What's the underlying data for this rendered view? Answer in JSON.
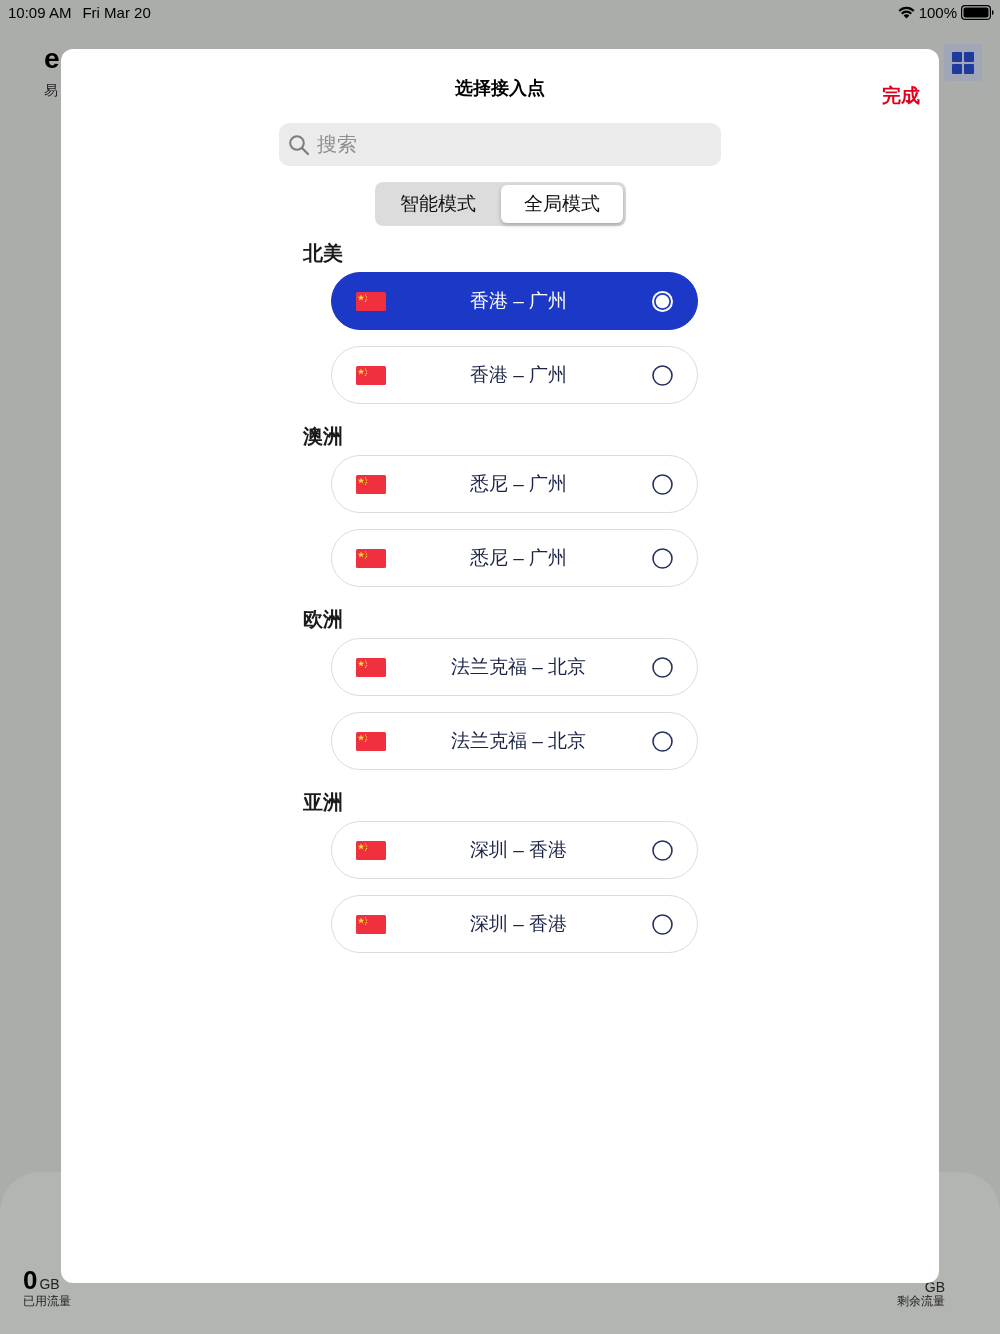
{
  "status_bar": {
    "time": "10:09 AM",
    "date": "Fri Mar 20",
    "battery": "100%"
  },
  "background": {
    "brand": "e",
    "brand_subtitle": "易",
    "stats": [
      {
        "value": "0",
        "unit": "GB",
        "label": "已用流量"
      },
      {
        "unit": "GB",
        "label": "剩余流量"
      }
    ]
  },
  "sheet": {
    "title": "选择接入点",
    "done": "完成",
    "search": {
      "placeholder": "搜索"
    },
    "modes": [
      {
        "label": "智能模式",
        "selected": false
      },
      {
        "label": "全局模式",
        "selected": true
      }
    ],
    "sections": [
      {
        "title": "北美",
        "nodes": [
          {
            "name": "香港 – 广州",
            "selected": true
          },
          {
            "name": "香港 – 广州",
            "selected": false
          }
        ]
      },
      {
        "title": "澳洲",
        "nodes": [
          {
            "name": "悉尼 – 广州",
            "selected": false
          },
          {
            "name": "悉尼 – 广州",
            "selected": false
          }
        ]
      },
      {
        "title": "欧洲",
        "nodes": [
          {
            "name": "法兰克福 – 北京",
            "selected": false
          },
          {
            "name": "法兰克福 – 北京",
            "selected": false
          }
        ]
      },
      {
        "title": "亚洲",
        "nodes": [
          {
            "name": "深圳 – 香港",
            "selected": false
          },
          {
            "name": "深圳 – 香港",
            "selected": false
          }
        ]
      }
    ]
  }
}
